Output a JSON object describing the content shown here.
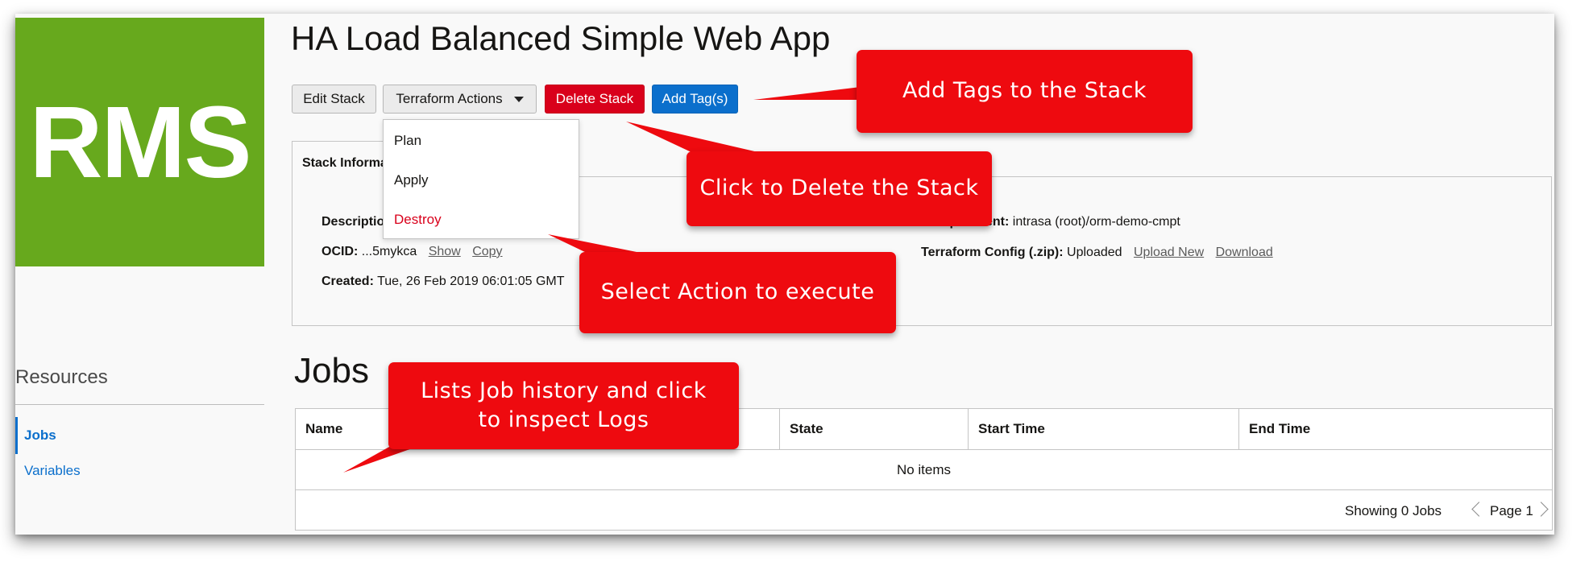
{
  "logo": {
    "text": "RMS"
  },
  "page_title": "HA Load Balanced Simple Web App",
  "toolbar": {
    "edit_label": "Edit Stack",
    "terraform_label": "Terraform Actions",
    "delete_label": "Delete Stack",
    "add_tag_label": "Add Tag(s)"
  },
  "terraform_menu": {
    "items": [
      {
        "label": "Plan"
      },
      {
        "label": "Apply"
      },
      {
        "label": "Destroy"
      }
    ]
  },
  "stack_info": {
    "tab_label": "Stack Information",
    "description_label": "Description:",
    "ocid_label": "OCID:",
    "ocid_value": "...5mykca",
    "show_link": "Show",
    "copy_link": "Copy",
    "created_label": "Created:",
    "created_value": "Tue, 26 Feb 2019 06:01:05 GMT",
    "compartment_label": "Compartment:",
    "compartment_value": "intrasa (root)/orm-demo-cmpt",
    "config_label": "Terraform Config (.zip):",
    "config_value": "Uploaded",
    "upload_link": "Upload New",
    "download_link": "Download"
  },
  "resources": {
    "title": "Resources",
    "items": [
      {
        "label": "Jobs",
        "active": true
      },
      {
        "label": "Variables",
        "active": false
      }
    ]
  },
  "jobs": {
    "title": "Jobs",
    "columns": [
      "Name",
      "State",
      "Start Time",
      "End Time"
    ],
    "empty_text": "No items",
    "showing_text": "Showing 0 Jobs",
    "page_text": "Page 1"
  },
  "callouts": {
    "add_tags": "Add Tags to the Stack",
    "delete": "Click to Delete the Stack",
    "select_action": "Select Action to execute",
    "jobs_line1": "Lists Job history and click",
    "jobs_line2": "to inspect Logs"
  },
  "colors": {
    "logo_green": "#67a91d",
    "delete_red": "#d9001b",
    "primary_blue": "#0b6fcc",
    "callout_red": "#ee0a0f"
  }
}
